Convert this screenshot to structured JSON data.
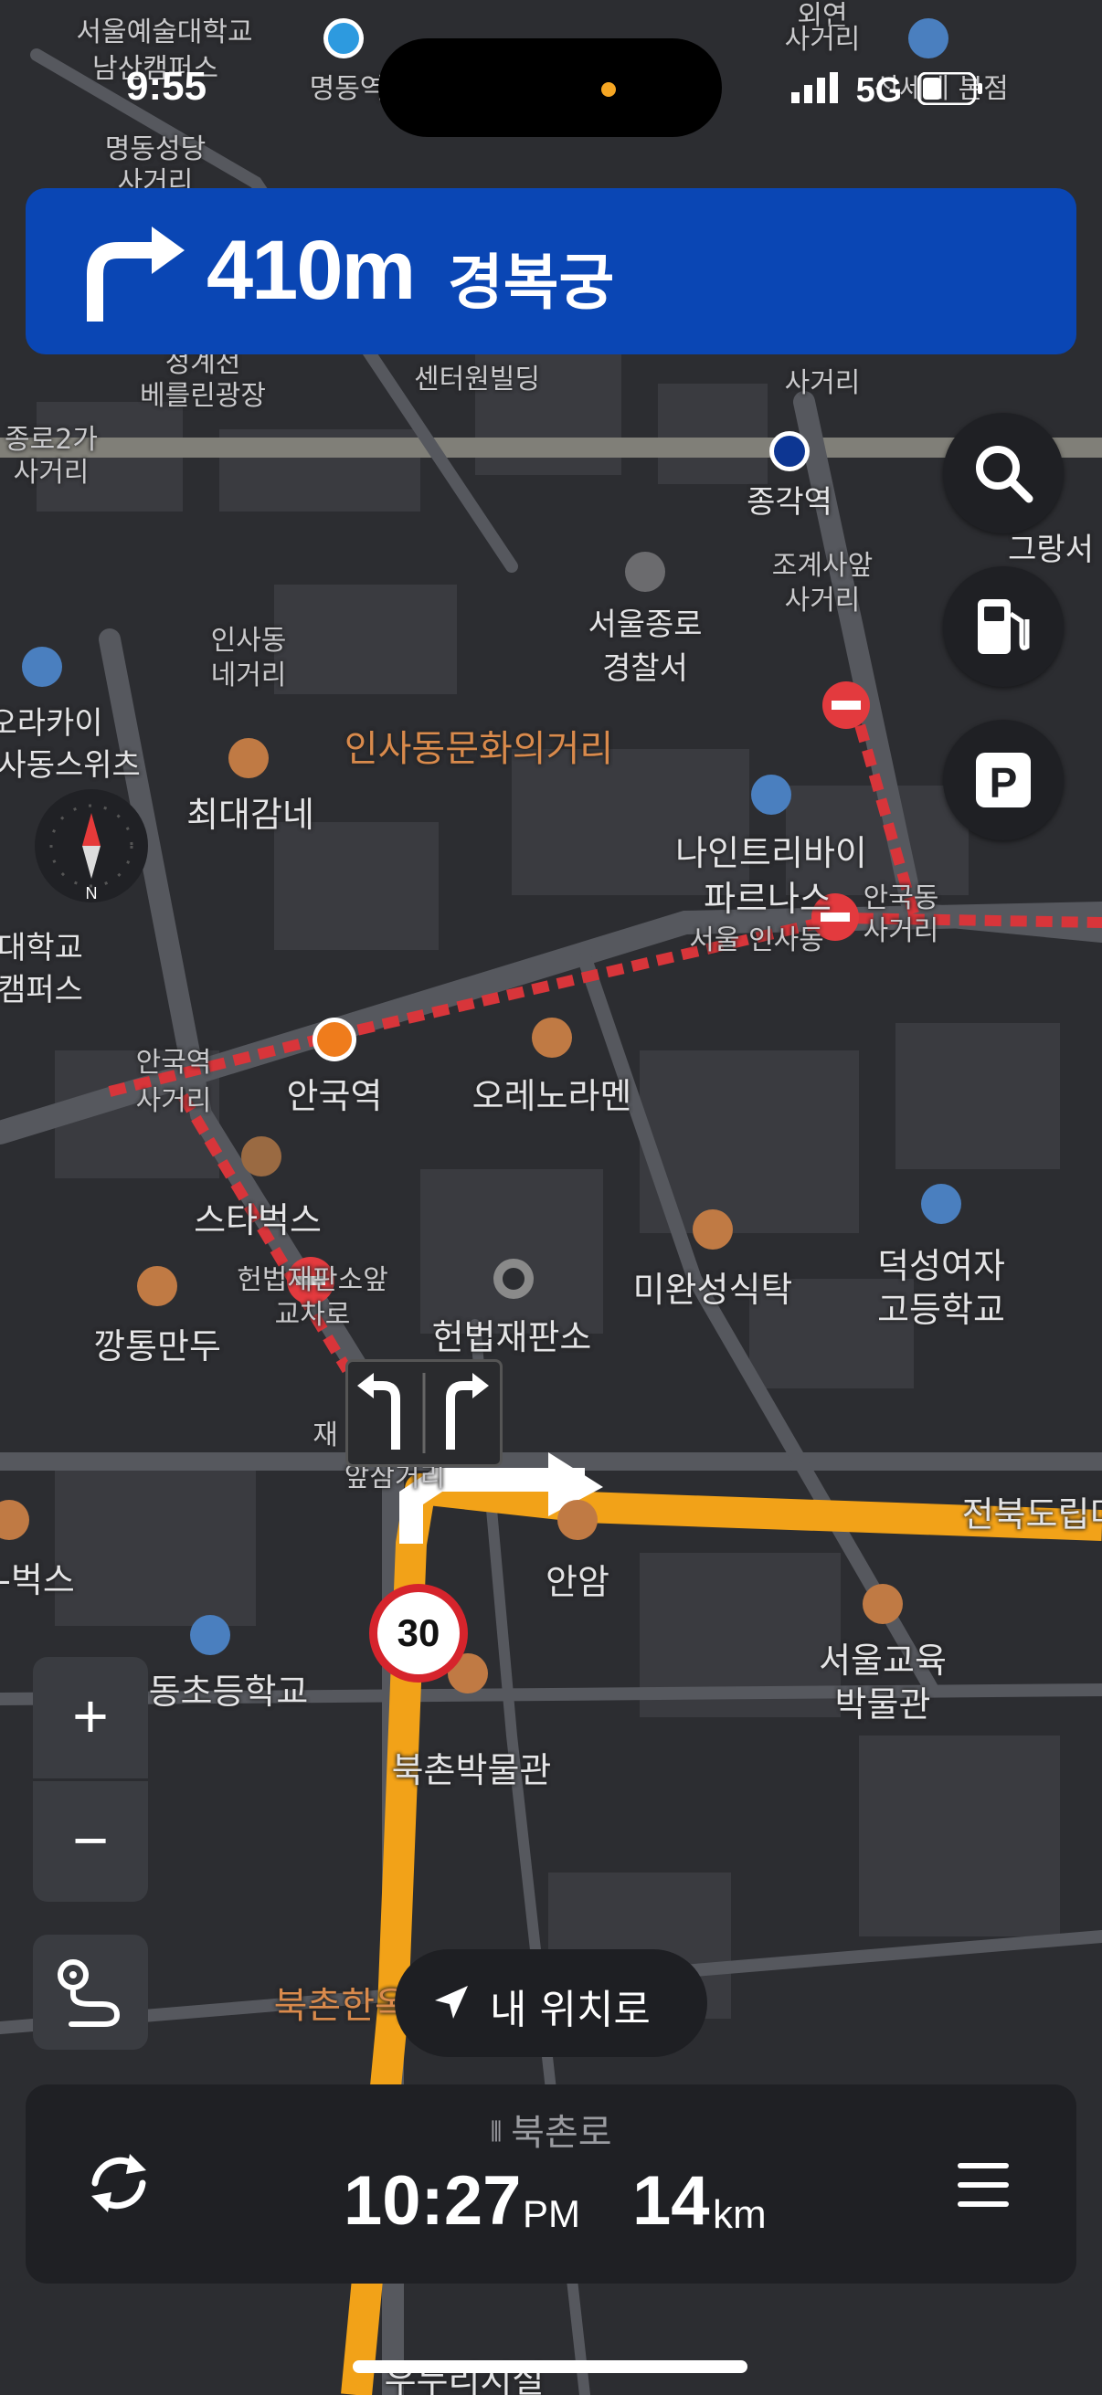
{
  "status": {
    "time": "9:55",
    "network": "5G"
  },
  "banner": {
    "distance": "410m",
    "destination": "경복궁",
    "maneuver_icon": "turn-right-icon"
  },
  "speed_limit": "30",
  "locate_label": "내 위치로",
  "panel": {
    "road": "북촌로",
    "eta": "10:27",
    "ampm": "PM",
    "distance": "14",
    "distance_unit": "km"
  },
  "compass_label": "N",
  "map_labels": {
    "seoul_arts": "서울예술대학교",
    "namsan": "남산캠퍼스",
    "myeongdong_station": "명동역",
    "myeongdong_cathedral": "명동성당",
    "cathedral_intersection": "사거리",
    "gwanghwa": "외연",
    "gwanghwa2": "사거리",
    "sinsegae": "신세계 본점",
    "gyeongbok_top": "정계천",
    "berlin": "베를린광장",
    "center_one": "센터원빌딩",
    "cheonggye": "사거리",
    "jongno2": "종로2가",
    "jongno2b": "사거리",
    "jonggak": "종각역",
    "jogye": "조계사앞",
    "jogye2": "사거리",
    "grand": "그랑서",
    "insadong": "인사동",
    "insadong2": "네거리",
    "police": "서울종로",
    "police2": "경찰서",
    "orakai": "오라카이",
    "orakai2": "인사동스위츠",
    "insadong_street": "인사동문화의거리",
    "choidae": "최대감네",
    "ninetree": "나인트리바이",
    "ninetree2": "파르나스",
    "ninetree3": "서울 인사동",
    "anguk_intersection": "안국동",
    "anguk_intersection2": "사거리",
    "university": "대학교",
    "campus": "캠퍼스",
    "anguk_station_x": "안국역",
    "anguk_station_x2": "사거리",
    "anguk": "안국역",
    "orenora": "오레노라멘",
    "starbucks": "스타벅스",
    "court_front": "헌법재판소앞",
    "court_front2": "교차로",
    "court": "헌법재판소",
    "miwan": "미완성식탁",
    "deoksung": "덕성여자",
    "deoksung2": "고등학교",
    "kkangtong": "깡통만두",
    "front_intersection": "앞삼거리",
    "jae": "재",
    "jeonbuk": "전북도립미",
    "bux": "-벅스",
    "anam": "안암",
    "dongcho": "동초등학교",
    "edu_museum": "서울교육",
    "edu_museum2": "박물관",
    "bukchon_museum": "북촌박물관",
    "bukchon_hanok": "북촌한옥마을",
    "bottom": "우누리시설"
  }
}
